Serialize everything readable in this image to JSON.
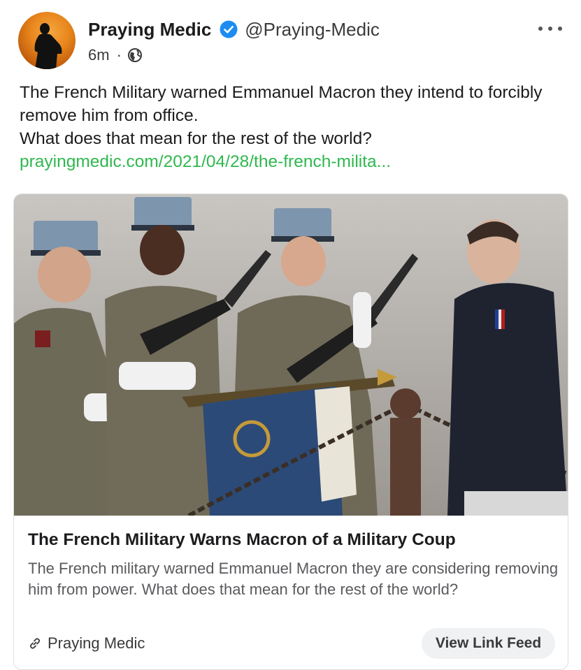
{
  "author": {
    "display_name": "Praying Medic",
    "handle": "@Praying-Medic",
    "verified": true,
    "avatar_icon": "silhouette-sunset-avatar"
  },
  "meta": {
    "time": "6m",
    "separator": "·",
    "visibility_icon": "globe-icon"
  },
  "post": {
    "text_lines": [
      "The French Military warned Emmanuel Macron they intend to forcibly remove him from office.",
      "What does that mean for the rest of the world?"
    ],
    "link_text": "prayingmedic.com/2021/04/28/the-french-milita..."
  },
  "link_card": {
    "title": "The French Military Warns Macron of a Military Coup",
    "description": "The French military warned Emmanuel Macron they are considering removing him from power. What does that mean for the rest of the world?",
    "source": "Praying Medic",
    "button_label": "View Link Feed"
  },
  "colors": {
    "link_green": "#2fb84f",
    "verified_blue": "#1d8cf2",
    "text_primary": "#1c1c1e",
    "text_secondary": "#5a5a5e"
  }
}
